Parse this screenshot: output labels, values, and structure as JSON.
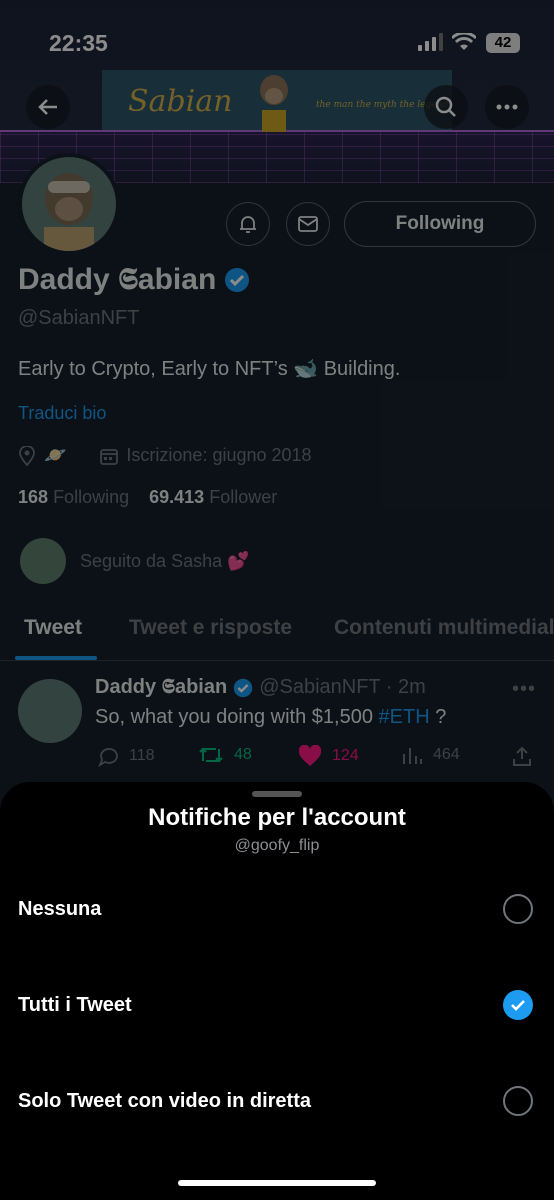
{
  "status": {
    "time": "22:35",
    "battery": "42"
  },
  "banner": {
    "name": "Sabian",
    "tagline": "the man the myth the legend"
  },
  "profile": {
    "display_name": "Daddy 𝕾abian",
    "handle": "@SabianNFT",
    "bio": "Early to Crypto, Early to NFT’s 🐋 Building.",
    "translate_link": "Traduci bio",
    "location_emoji": "🪐",
    "joined": "Iscrizione: giugno 2018",
    "following_count": "168",
    "following_label": "Following",
    "followers_count": "69.413",
    "followers_label": "Follower",
    "followed_by": "Seguito da Sasha 💕",
    "follow_button": "Following"
  },
  "tabs": [
    "Tweet",
    "Tweet e risposte",
    "Contenuti multimediali"
  ],
  "tweet": {
    "name": "Daddy 𝕾abian",
    "handle_time": "@SabianNFT · 2m",
    "text_prefix": "So, what you doing with $1,500 ",
    "hashtag": "#ETH",
    "text_suffix": " ?",
    "replies": "118",
    "retweets": "48",
    "likes": "124",
    "views": "464"
  },
  "sheet": {
    "title": "Notifiche per l'account",
    "subtitle": "@goofy_flip",
    "options": [
      {
        "label": "Nessuna",
        "selected": false
      },
      {
        "label": "Tutti i Tweet",
        "selected": true
      },
      {
        "label": "Solo Tweet con video in diretta",
        "selected": false
      }
    ]
  },
  "colors": {
    "accent": "#1d9bf0",
    "retweet": "#00ba7c",
    "like": "#f91880",
    "background": "#15202b"
  }
}
